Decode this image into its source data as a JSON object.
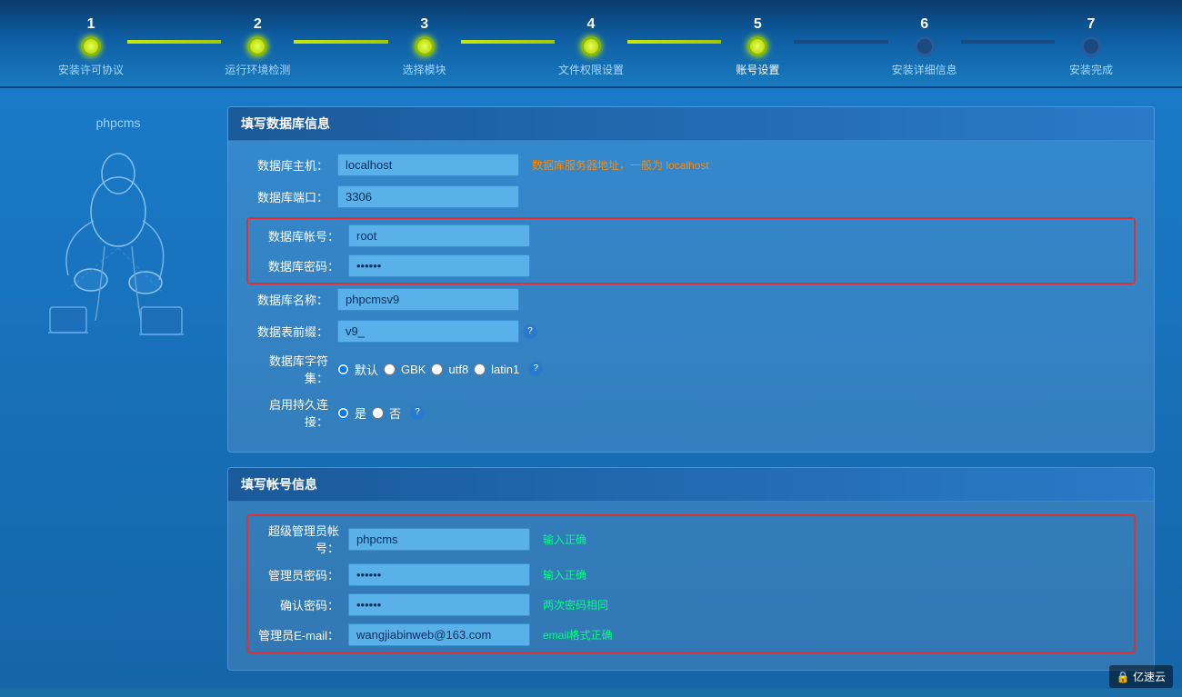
{
  "steps": [
    {
      "number": "1",
      "label": "安装许可协议",
      "active": true
    },
    {
      "number": "2",
      "label": "运行环境检测",
      "active": true
    },
    {
      "number": "3",
      "label": "选择模块",
      "active": true
    },
    {
      "number": "4",
      "label": "文件权限设置",
      "active": true
    },
    {
      "number": "5",
      "label": "账号设置",
      "active": true
    },
    {
      "number": "6",
      "label": "安装详细信息",
      "active": false
    },
    {
      "number": "7",
      "label": "安装完成",
      "active": false
    }
  ],
  "db_section": {
    "title": "填写数据库信息",
    "fields": [
      {
        "label": "数据库主机：",
        "value": "localhost",
        "hint": "数据库服务器地址，一般为 localhost",
        "hint_type": "orange"
      },
      {
        "label": "数据库端口：",
        "value": "3306",
        "hint": "",
        "hint_type": ""
      },
      {
        "label": "数据库帐号：",
        "value": "root",
        "hint": "",
        "hint_type": "highlighted"
      },
      {
        "label": "数据库密码：",
        "value": "••••••",
        "hint": "",
        "hint_type": "highlighted"
      },
      {
        "label": "数据库名称：",
        "value": "phpcmsv9",
        "hint": "",
        "hint_type": ""
      },
      {
        "label": "数据表前缀：",
        "value": "v9_",
        "hint": "?",
        "hint_type": "help"
      }
    ],
    "charset_label": "数据库字符集：",
    "charset_options": [
      "默认",
      "GBK",
      "utf8",
      "latin1"
    ],
    "charset_selected": "默认",
    "persist_label": "启用持久连接：",
    "persist_options": [
      "是",
      "否"
    ],
    "persist_selected": "是"
  },
  "account_section": {
    "title": "填写帐号信息",
    "fields": [
      {
        "label": "超级管理员帐号：",
        "value": "phpcms",
        "hint": "输入正确",
        "hint_type": "green"
      },
      {
        "label": "管理员密码：",
        "value": "••••••",
        "hint": "输入正确",
        "hint_type": "green"
      },
      {
        "label": "确认密码：",
        "value": "••••••",
        "hint": "两次密码相同",
        "hint_type": "green"
      },
      {
        "label": "管理员E-mail：",
        "value": "wangjiabinweb@163.com",
        "hint": "email格式正确",
        "hint_type": "green"
      }
    ]
  },
  "logo": {
    "text": "phpcms"
  },
  "watermark": "亿速云"
}
